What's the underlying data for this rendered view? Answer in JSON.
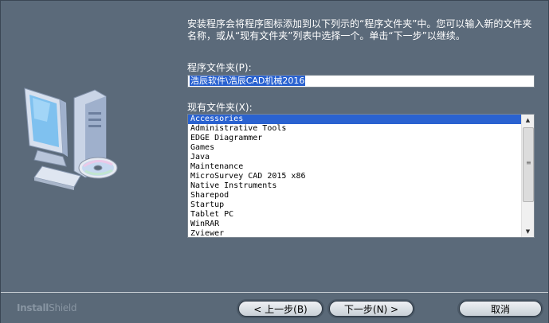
{
  "intro_text": "安装程序会将程序图标添加到以下列示的“程序文件夹”中。您可以输入新的文件夹名称，或从“现有文件夹”列表中选择一个。单击“下一步”以继续。",
  "program_folder": {
    "label": "程序文件夹(P):",
    "value": "浩辰软件\\浩辰CAD机械2016"
  },
  "existing_folders": {
    "label": "现有文件夹(X):",
    "items": [
      "Accessories",
      "Administrative Tools",
      "EDGE Diagrammer",
      "Games",
      "Java",
      "Maintenance",
      "MicroSurvey CAD 2015 x86",
      "Native Instruments",
      "Sharepod",
      "Startup",
      "Tablet PC",
      "WinRAR",
      "Zviewer"
    ],
    "selected_index": 0
  },
  "footer": {
    "brand_bold": "Install",
    "brand_light": "Shield",
    "back_label": "< 上一步(B)",
    "next_label": "下一步(N) >",
    "cancel_label": "取消"
  },
  "colors": {
    "background": "#5b6a7a",
    "selection": "#2a62d0"
  }
}
